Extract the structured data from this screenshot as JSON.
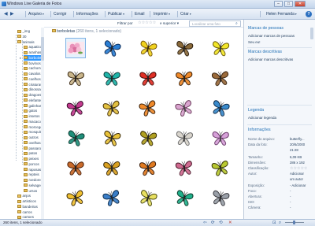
{
  "window": {
    "title": "Windows Live Galeria de Fotos",
    "min": "–",
    "max": "□",
    "close": "✕"
  },
  "toolbar": {
    "items": [
      {
        "label": "Arquivo",
        "dd": "▾"
      },
      {
        "label": "Corrigir",
        "dd": ""
      },
      {
        "label": "Informações",
        "dd": ""
      },
      {
        "label": "Publicar",
        "dd": "▾"
      },
      {
        "label": "Email",
        "dd": ""
      },
      {
        "label": "Imprimir",
        "dd": "▾"
      },
      {
        "label": "Criar",
        "dd": "▾"
      }
    ],
    "user": "Helen Fernanda",
    "user_dd": "▾",
    "help": "?"
  },
  "filter": {
    "label": "Filtrar por",
    "stars": "☆☆☆☆☆",
    "condition": "e superior",
    "search_placeholder": "Localizar uma foto"
  },
  "sidebar": {
    "folders": [
      "_img",
      "30",
      "animais",
      "aquaticos",
      "aranhas",
      "borboletas",
      "bovinos",
      "cachorros",
      "cavalos",
      "coelhos",
      "criaturas",
      "dinossauros",
      "dragoes",
      "elefantes",
      "galinhas",
      "gatos",
      "insetos",
      "macacos",
      "morcegos",
      "mosquitos",
      "outros",
      "ovelhas",
      "passaros",
      "patos",
      "peixes",
      "porcos",
      "raposas",
      "repteis",
      "roedores",
      "selvagens",
      "ursos",
      "anjos",
      "artisticos",
      "bandeiras",
      "carros",
      "cartoes"
    ],
    "selected": "borboletas",
    "cursor": "▸"
  },
  "gallery": {
    "folder": "borboletas",
    "count": "(260 itens, 1 selecionado)",
    "icon": "folder-icon"
  },
  "panel": {
    "people_header": "Marcas de pessoas",
    "people_add": "Adicionar marcas de pessoas",
    "people_me": "Seu eu!",
    "desc_header": "Marcas descritivas",
    "desc_add": "Adicionar marcas descritivas",
    "caption_header": "Legenda",
    "caption_add": "Adicionar legenda",
    "info_header": "Informações",
    "info": [
      {
        "k": "Nome do arquivo:",
        "v": "butterfly..."
      },
      {
        "k": "Data da foto:",
        "v": "20/6/2000"
      },
      {
        "k": "",
        "v": "21:28"
      },
      {
        "k": "Tamanho:",
        "v": "6,09 KB"
      },
      {
        "k": "Dimensões:",
        "v": "286 x 192"
      },
      {
        "k": "Classificação:",
        "v": "☆☆☆☆☆"
      },
      {
        "k": "Autor:",
        "v": "Adicionar"
      },
      {
        "k": "",
        "v": "um autor"
      },
      {
        "k": "Exposição:",
        "v": "- Adicionar"
      },
      {
        "k": "Foco:",
        "v": "-"
      },
      {
        "k": "Abertura:",
        "v": "-"
      },
      {
        "k": "ISO:",
        "v": "-"
      },
      {
        "k": "Câmera:",
        "v": "-"
      }
    ]
  },
  "status": {
    "text": "260 itens, 1 selecionado",
    "icons": [
      "⇦",
      "⟳",
      "⟲",
      "✕",
      "⊡",
      "⌕"
    ]
  },
  "colors": {
    "accent": "#3399ff",
    "link": "#1f6fb5",
    "titlebar": "#c4d6ec"
  },
  "thumbs": [
    {
      "kind": "flower",
      "name": "flower"
    },
    {
      "kind": "bfly",
      "wing": "#2b7fd4",
      "edge": "#0a2b5a",
      "body": "#222",
      "name": "blue-butterfly"
    },
    {
      "kind": "bfly",
      "wing": "#f0d21e",
      "edge": "#7a5a08",
      "body": "#3a2a10",
      "name": "yellow-butterfly"
    },
    {
      "kind": "bfly",
      "wing": "#8a6a3a",
      "edge": "#2a1c0c",
      "body": "#222",
      "name": "brown-butterfly"
    },
    {
      "kind": "bfly",
      "wing": "#f2e628",
      "edge": "#6a5a06",
      "body": "#333",
      "name": "yellow-butterfly"
    },
    {
      "kind": "bfly",
      "wing": "#c9b58a",
      "edge": "#3b2a14",
      "body": "#222",
      "name": "moth-butterfly"
    },
    {
      "kind": "bfly",
      "wing": "#1fb4a8",
      "edge": "#0d3a3a",
      "body": "#222",
      "name": "teal-butterfly"
    },
    {
      "kind": "bfly",
      "wing": "#e02f25",
      "edge": "#4a0a06",
      "body": "#222",
      "name": "red-butterfly"
    },
    {
      "kind": "bfly",
      "wing": "#f08a2a",
      "edge": "#3a1e06",
      "body": "#222",
      "name": "orange-butterfly"
    },
    {
      "kind": "bfly",
      "wing": "#9a6a3a",
      "edge": "#3a2410",
      "body": "#222",
      "name": "brown-butterfly"
    },
    {
      "kind": "bfly",
      "wing": "#c43b8f",
      "edge": "#3a0a2a",
      "body": "#222",
      "name": "magenta-butterfly"
    },
    {
      "kind": "bfly",
      "wing": "#e2c040",
      "edge": "#4a3406",
      "body": "#222",
      "name": "yellow-butterfly"
    },
    {
      "kind": "bfly",
      "wing": "#f08a2a",
      "edge": "#3a1e06",
      "body": "#222",
      "name": "orange-butterfly"
    },
    {
      "kind": "bfly",
      "wing": "#d9a4cf",
      "edge": "#6a3a5a",
      "body": "#444",
      "name": "pink-butterfly"
    },
    {
      "kind": "bfly",
      "wing": "#3a8acb",
      "edge": "#0a2a4a",
      "body": "#222",
      "name": "blue-butterfly"
    },
    {
      "kind": "bfly",
      "wing": "#1f8f7a",
      "edge": "#0a3a30",
      "body": "#222",
      "name": "green-butterfly"
    },
    {
      "kind": "bfly",
      "wing": "#e8c23a",
      "edge": "#3a2a06",
      "body": "#222",
      "name": "yellow-butterfly"
    },
    {
      "kind": "bfly",
      "wing": "#b0a020",
      "edge": "#3a3006",
      "body": "#222",
      "name": "olive-butterfly"
    },
    {
      "kind": "bfly",
      "wing": "#d8d4cc",
      "edge": "#6a6a6a",
      "body": "#333",
      "name": "white-butterfly"
    },
    {
      "kind": "bfly",
      "wing": "#d6a0d8",
      "edge": "#6a3a6a",
      "body": "#444",
      "name": "pink-butterfly"
    },
    {
      "kind": "bfly",
      "wing": "#c96a2a",
      "edge": "#4a1e06",
      "body": "#222",
      "name": "orange-butterfly"
    },
    {
      "kind": "bfly",
      "wing": "#d9a020",
      "edge": "#3a2a06",
      "body": "#222",
      "name": "orange-butterfly"
    },
    {
      "kind": "bfly",
      "wing": "#e07a20",
      "edge": "#3a1a06",
      "body": "#222",
      "name": "orange-butterfly"
    },
    {
      "kind": "bfly",
      "wing": "#d06a90",
      "edge": "#4a1a2a",
      "body": "#222",
      "name": "pink-butterfly"
    },
    {
      "kind": "bfly",
      "wing": "#b8c830",
      "edge": "#3a3a0a",
      "body": "#222",
      "name": "lime-butterfly"
    },
    {
      "kind": "bfly",
      "wing": "#f0c030",
      "edge": "#3a2a06",
      "body": "#222",
      "name": "yellow-butterfly"
    },
    {
      "kind": "bfly",
      "wing": "#3a7ec8",
      "edge": "#0a2a4a",
      "body": "#222",
      "name": "blue-butterfly"
    },
    {
      "kind": "bfly",
      "wing": "#e8e060",
      "edge": "#4a4a10",
      "body": "#222",
      "name": "yellow-butterfly"
    },
    {
      "kind": "bfly",
      "wing": "#1fb08a",
      "edge": "#0a3a2a",
      "body": "#222",
      "name": "green-butterfly"
    },
    {
      "kind": "bfly",
      "wing": "#9aa0a8",
      "edge": "#3a3a40",
      "body": "#222",
      "name": "grey-butterfly"
    }
  ]
}
